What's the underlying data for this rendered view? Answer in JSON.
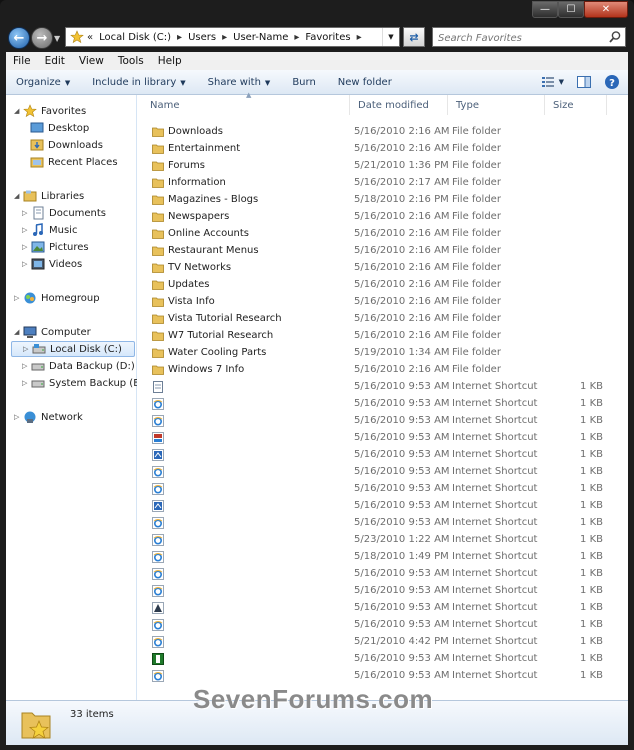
{
  "caption": {
    "minimize": "—",
    "maximize": "☐",
    "close": "✕"
  },
  "address": {
    "prefix": "«",
    "crumbs": [
      "Local Disk (C:)",
      "Users",
      "User-Name",
      "Favorites"
    ],
    "search_placeholder": "Search Favorites"
  },
  "menu": [
    "File",
    "Edit",
    "View",
    "Tools",
    "Help"
  ],
  "commands": {
    "organize": "Organize",
    "include": "Include in library",
    "share": "Share with",
    "burn": "Burn",
    "new_folder": "New folder"
  },
  "nav": {
    "favorites": "Favorites",
    "desktop": "Desktop",
    "downloads": "Downloads",
    "recent": "Recent Places",
    "libraries": "Libraries",
    "documents": "Documents",
    "music": "Music",
    "pictures": "Pictures",
    "videos": "Videos",
    "homegroup": "Homegroup",
    "computer": "Computer",
    "local_disk": "Local Disk (C:)",
    "data_backup": "Data Backup (D:)",
    "system_backup": "System Backup (E:)",
    "network": "Network"
  },
  "columns": {
    "name": "Name",
    "date": "Date modified",
    "type": "Type",
    "size": "Size"
  },
  "folders": [
    {
      "name": "Downloads",
      "date": "5/16/2010 2:16 AM",
      "type": "File folder"
    },
    {
      "name": "Entertainment",
      "date": "5/16/2010 2:16 AM",
      "type": "File folder"
    },
    {
      "name": "Forums",
      "date": "5/21/2010 1:36 PM",
      "type": "File folder"
    },
    {
      "name": "Information",
      "date": "5/16/2010 2:17 AM",
      "type": "File folder"
    },
    {
      "name": "Magazines - Blogs",
      "date": "5/18/2010 2:16 PM",
      "type": "File folder"
    },
    {
      "name": "Newspapers",
      "date": "5/16/2010 2:16 AM",
      "type": "File folder"
    },
    {
      "name": "Online Accounts",
      "date": "5/16/2010 2:16 AM",
      "type": "File folder"
    },
    {
      "name": "Restaurant Menus",
      "date": "5/16/2010 2:16 AM",
      "type": "File folder"
    },
    {
      "name": "TV Networks",
      "date": "5/16/2010 2:16 AM",
      "type": "File folder"
    },
    {
      "name": "Updates",
      "date": "5/16/2010 2:16 AM",
      "type": "File folder"
    },
    {
      "name": "Vista Info",
      "date": "5/16/2010 2:16 AM",
      "type": "File folder"
    },
    {
      "name": "Vista Tutorial Research",
      "date": "5/16/2010 2:16 AM",
      "type": "File folder"
    },
    {
      "name": "W7 Tutorial Research",
      "date": "5/16/2010 2:16 AM",
      "type": "File folder"
    },
    {
      "name": "Water Cooling Parts",
      "date": "5/19/2010 1:34 AM",
      "type": "File folder"
    },
    {
      "name": "Windows 7 Info",
      "date": "5/16/2010 2:16 AM",
      "type": "File folder"
    }
  ],
  "shortcuts": [
    {
      "date": "5/16/2010 9:53 AM",
      "type": "Internet Shortcut",
      "size": "1 KB",
      "icon": "page-icon"
    },
    {
      "date": "5/16/2010 9:53 AM",
      "type": "Internet Shortcut",
      "size": "1 KB",
      "icon": "ie-icon"
    },
    {
      "date": "5/16/2010 9:53 AM",
      "type": "Internet Shortcut",
      "size": "1 KB",
      "icon": "ie-icon"
    },
    {
      "date": "5/16/2010 9:53 AM",
      "type": "Internet Shortcut",
      "size": "1 KB",
      "icon": "red-site-icon"
    },
    {
      "date": "5/16/2010 9:53 AM",
      "type": "Internet Shortcut",
      "size": "1 KB",
      "icon": "blue-site-icon"
    },
    {
      "date": "5/16/2010 9:53 AM",
      "type": "Internet Shortcut",
      "size": "1 KB",
      "icon": "ie-icon"
    },
    {
      "date": "5/16/2010 9:53 AM",
      "type": "Internet Shortcut",
      "size": "1 KB",
      "icon": "ie-icon"
    },
    {
      "date": "5/16/2010 9:53 AM",
      "type": "Internet Shortcut",
      "size": "1 KB",
      "icon": "blue-site-icon"
    },
    {
      "date": "5/16/2010 9:53 AM",
      "type": "Internet Shortcut",
      "size": "1 KB",
      "icon": "ie-icon"
    },
    {
      "date": "5/23/2010 1:22 AM",
      "type": "Internet Shortcut",
      "size": "1 KB",
      "icon": "ie-icon"
    },
    {
      "date": "5/18/2010 1:49 PM",
      "type": "Internet Shortcut",
      "size": "1 KB",
      "icon": "ie-icon"
    },
    {
      "date": "5/16/2010 9:53 AM",
      "type": "Internet Shortcut",
      "size": "1 KB",
      "icon": "ie-icon"
    },
    {
      "date": "5/16/2010 9:53 AM",
      "type": "Internet Shortcut",
      "size": "1 KB",
      "icon": "ie-icon"
    },
    {
      "date": "5/16/2010 9:53 AM",
      "type": "Internet Shortcut",
      "size": "1 KB",
      "icon": "dark-site-icon"
    },
    {
      "date": "5/16/2010 9:53 AM",
      "type": "Internet Shortcut",
      "size": "1 KB",
      "icon": "ie-icon"
    },
    {
      "date": "5/21/2010 4:42 PM",
      "type": "Internet Shortcut",
      "size": "1 KB",
      "icon": "ie-icon"
    },
    {
      "date": "5/16/2010 9:53 AM",
      "type": "Internet Shortcut",
      "size": "1 KB",
      "icon": "green-site-icon"
    },
    {
      "date": "5/16/2010 9:53 AM",
      "type": "Internet Shortcut",
      "size": "1 KB",
      "icon": "ie-icon"
    }
  ],
  "status": {
    "item_count": "33 items"
  },
  "watermark": "SevenForums.com",
  "colors": {
    "accent": "#1f5fa8",
    "folder": "#e8c15b",
    "selection": "#d6e8fb"
  }
}
